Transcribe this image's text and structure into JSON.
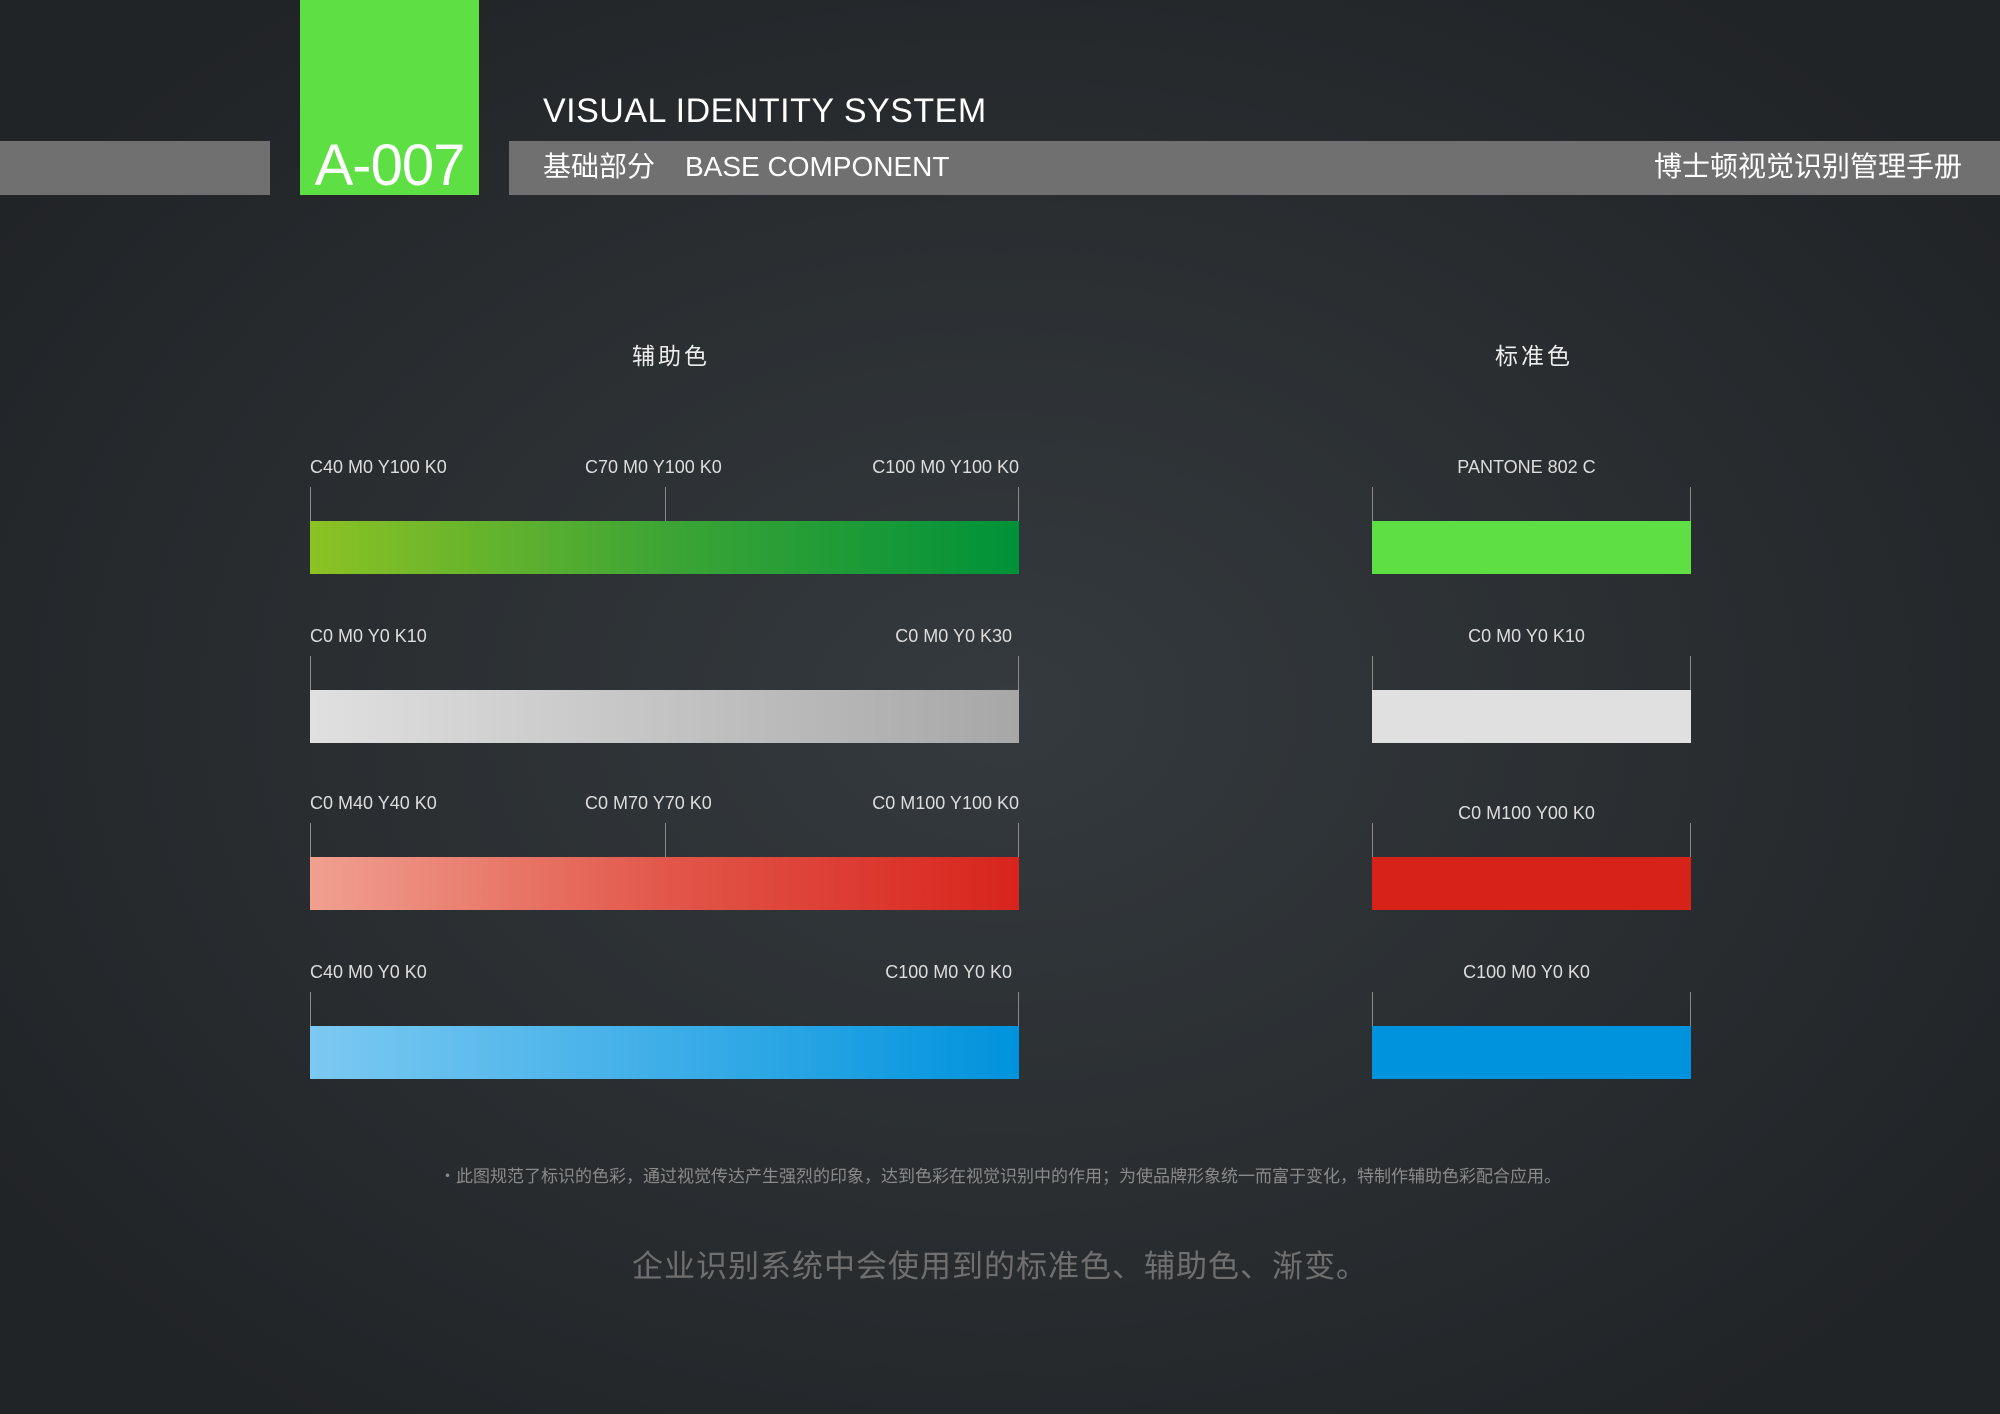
{
  "header": {
    "code": "A-007",
    "system_title": "VISUAL IDENTITY SYSTEM",
    "section_cn": "基础部分",
    "section_en": "BASE COMPONENT",
    "manual_title": "博士顿视觉识别管理手册"
  },
  "columns": {
    "auxiliary_title": "辅助色",
    "standard_title": "标准色"
  },
  "gradients": [
    {
      "labels": [
        "C40 M0 Y100 K0",
        "C70 M0 Y100 K0",
        "C100 M0 Y100 K0"
      ],
      "colors": [
        "#8cc224",
        "#3da535",
        "#009239"
      ]
    },
    {
      "labels": [
        "C0 M0 Y0 K10",
        "C0 M0 Y0 K30"
      ],
      "colors": [
        "#e0e0e0",
        "#a7a7a7"
      ]
    },
    {
      "labels": [
        "C0 M40 Y40 K0",
        "C0 M70 Y70 K0",
        "C0 M100 Y100 K0"
      ],
      "colors": [
        "#f0a090",
        "#e2574a",
        "#d8241c"
      ]
    },
    {
      "labels": [
        "C40 M0 Y0 K0",
        "C100 M0 Y0 K0"
      ],
      "colors": [
        "#7cc9f2",
        "#0093dd"
      ]
    }
  ],
  "standards": [
    {
      "label": "PANTONE 802 C",
      "color": "#5ee044"
    },
    {
      "label": "C0 M0 Y0 K10",
      "color": "#e0e0e0"
    },
    {
      "label": "C0 M100 Y00 K0",
      "color": "#d7221a"
    },
    {
      "label": "C100 M0 Y0 K0",
      "color": "#0093dd"
    }
  ],
  "footer": {
    "note": "・此图规范了标识的色彩，通过视觉传达产生强烈的印象，达到色彩在视觉识别中的作用；为使品牌形象统一而富于变化，特制作辅助色彩配合应用。",
    "summary": "企业识别系统中会使用到的标准色、辅助色、渐变。"
  }
}
